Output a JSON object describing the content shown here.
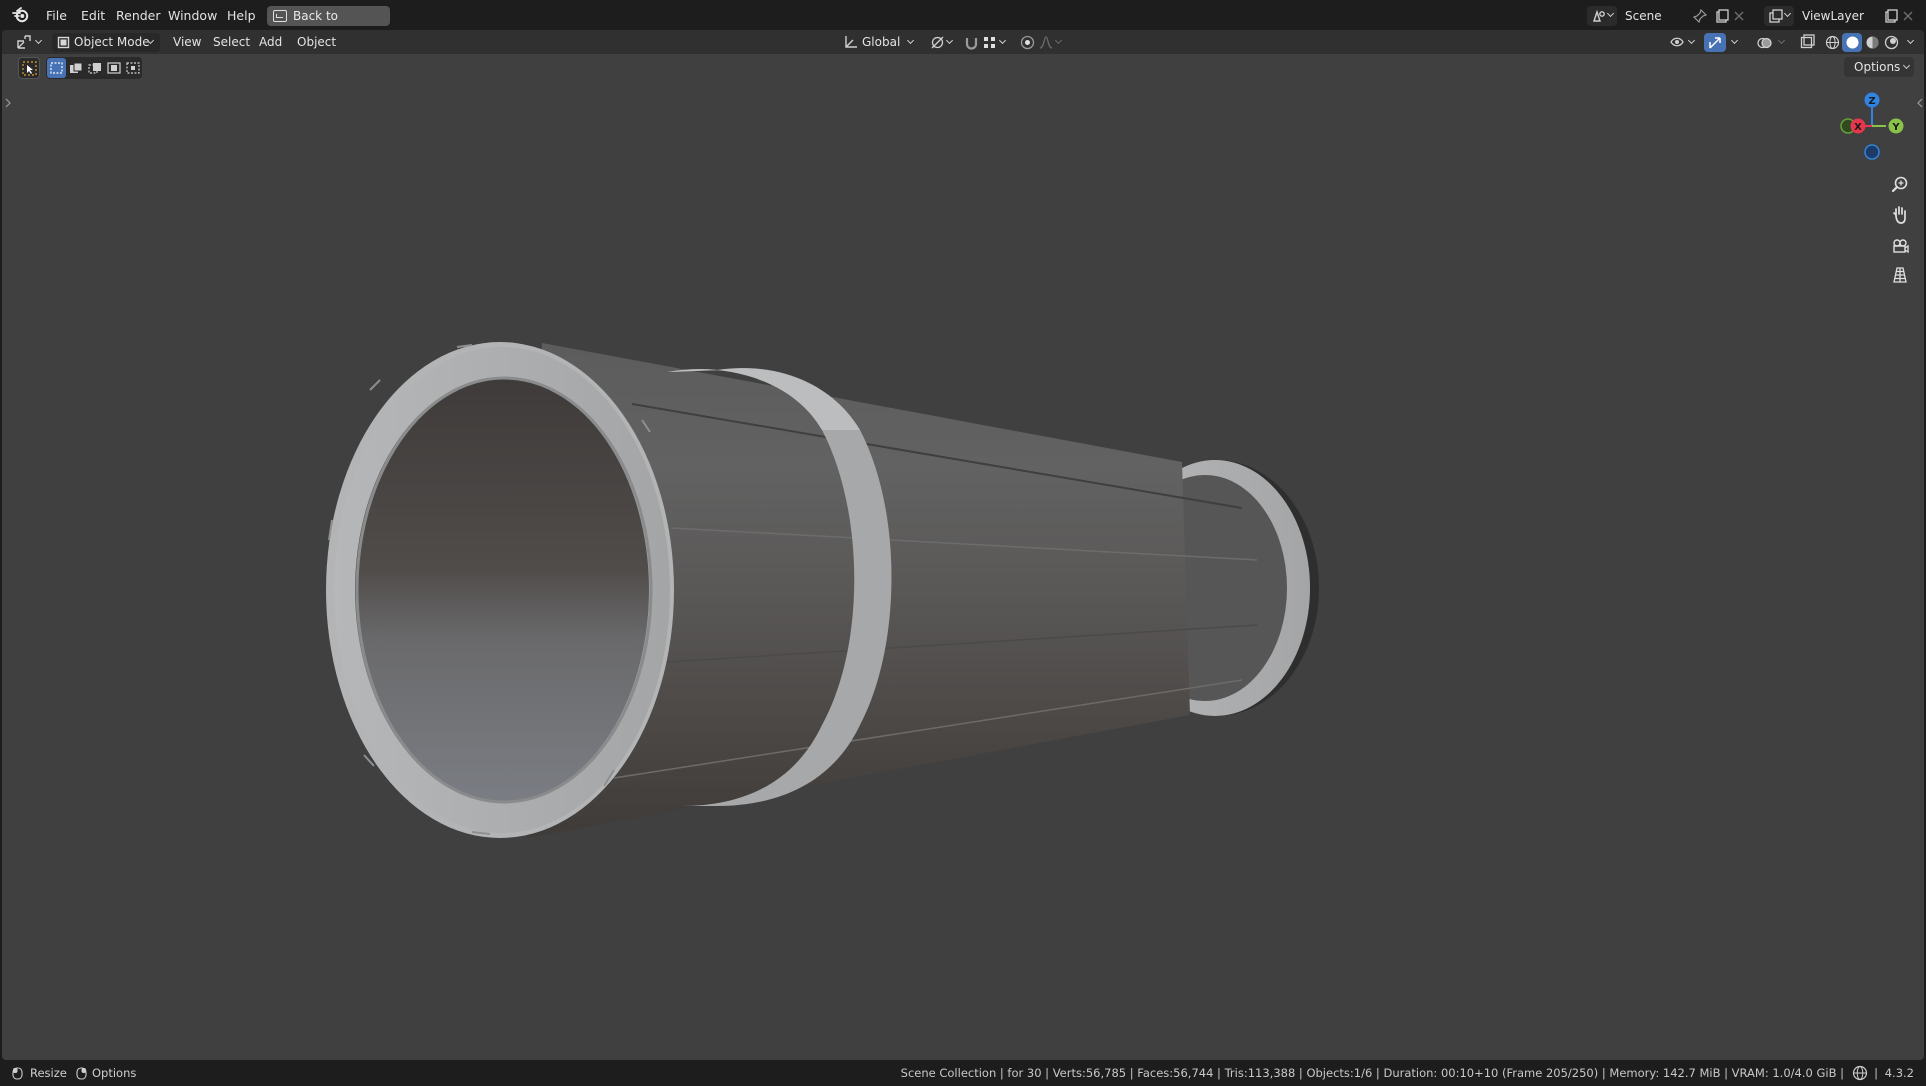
{
  "topbar": {
    "menu": [
      "File",
      "Edit",
      "Render",
      "Window",
      "Help"
    ],
    "back_button": "Back to Previous",
    "scene_name": "Scene",
    "view_layer": "ViewLayer"
  },
  "header": {
    "mode": "Object Mode",
    "menus": [
      "View",
      "Select",
      "Add",
      "Object"
    ],
    "orientation": "Global"
  },
  "viewport": {
    "options_label": "Options",
    "gizmo": {
      "x": "X",
      "y": "Y",
      "z": "Z"
    },
    "object": "Cylindrical tube with two rim rings (grey solid shading)"
  },
  "statusbar": {
    "resize_label": "Resize",
    "options_label": "Options",
    "stats": "Scene Collection | for 30 | Verts:56,785 | Faces:56,744 | Tris:113,388 | Objects:1/6 | Duration: 00:10+10 (Frame 205/250) | Memory: 142.7 MiB | VRAM: 1.0/4.0 GiB |",
    "version": "4.3.2"
  },
  "colors": {
    "bar": "#1d1d1d",
    "header": "#303030",
    "viewport": "#404040",
    "accent_blue": "#4772b3",
    "axis_x": "#e8364f",
    "axis_y": "#8bc34a",
    "axis_z": "#2f84e3"
  }
}
